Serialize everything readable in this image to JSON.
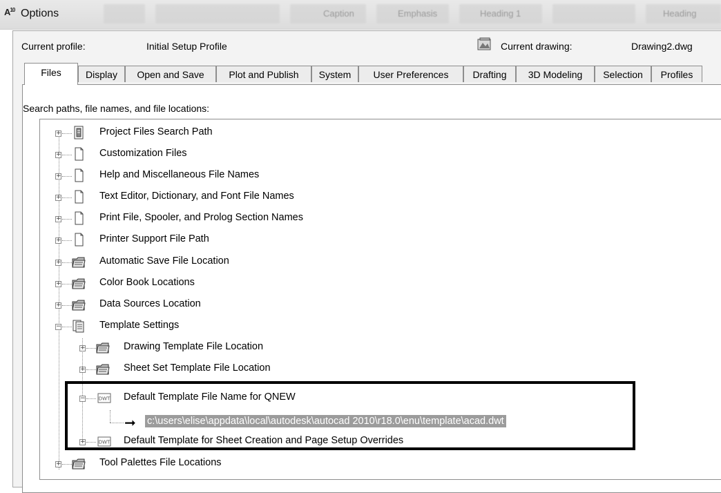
{
  "window": {
    "title": "Options",
    "app_icon": "autocad-icon",
    "app_icon_text": "A",
    "app_icon_sub": "10",
    "background_ribbon": [
      "Caption",
      "Emphasis",
      "Heading 1",
      "Heading"
    ]
  },
  "profile": {
    "current_profile_label": "Current profile:",
    "current_profile_value": "Initial Setup Profile",
    "current_drawing_label": "Current drawing:",
    "current_drawing_value": "Drawing2.dwg"
  },
  "tabs": [
    {
      "label": "Files",
      "active": true
    },
    {
      "label": "Display"
    },
    {
      "label": "Open and Save"
    },
    {
      "label": "Plot and Publish"
    },
    {
      "label": "System"
    },
    {
      "label": "User Preferences"
    },
    {
      "label": "Drafting"
    },
    {
      "label": "3D Modeling"
    },
    {
      "label": "Selection"
    },
    {
      "label": "Profiles"
    }
  ],
  "files_tab": {
    "caption": "Search paths, file names, and file locations:",
    "tree": [
      {
        "label": "Project Files Search Path",
        "icon": "project-path-icon",
        "expanded": false
      },
      {
        "label": "Customization Files",
        "icon": "document-icon",
        "expanded": false
      },
      {
        "label": "Help and Miscellaneous File Names",
        "icon": "document-icon",
        "expanded": false
      },
      {
        "label": "Text Editor, Dictionary, and Font File Names",
        "icon": "document-icon",
        "expanded": false
      },
      {
        "label": "Print File, Spooler, and Prolog Section Names",
        "icon": "document-icon",
        "expanded": false
      },
      {
        "label": "Printer Support File Path",
        "icon": "document-icon",
        "expanded": false
      },
      {
        "label": "Automatic Save File Location",
        "icon": "folder-icon",
        "expanded": false
      },
      {
        "label": "Color Book Locations",
        "icon": "folder-icon",
        "expanded": false
      },
      {
        "label": "Data Sources Location",
        "icon": "folder-icon",
        "expanded": false
      },
      {
        "label": "Template Settings",
        "icon": "template-icon",
        "expanded": true
      },
      {
        "label": "Drawing Template File Location",
        "icon": "folder-icon",
        "expanded": false
      },
      {
        "label": "Sheet Set Template File Location",
        "icon": "folder-icon",
        "expanded": false
      },
      {
        "label": "Default Template File Name for QNEW",
        "icon": "dwt-file-icon",
        "expanded": true
      },
      {
        "label": "c:\\users\\elise\\appdata\\local\\autodesk\\autocad 2010\\r18.0\\enu\\template\\acad.dwt",
        "icon": "arrow-right-icon",
        "selected": true
      },
      {
        "label": "Default Template for Sheet Creation and Page Setup Overrides",
        "icon": "dwt-file-icon",
        "expanded": false
      },
      {
        "label": "Tool Palettes File Locations",
        "icon": "folder-icon",
        "expanded": false
      }
    ]
  },
  "colors": {
    "selection_bg": "#9c9c9c",
    "highlight_border": "#000000"
  }
}
